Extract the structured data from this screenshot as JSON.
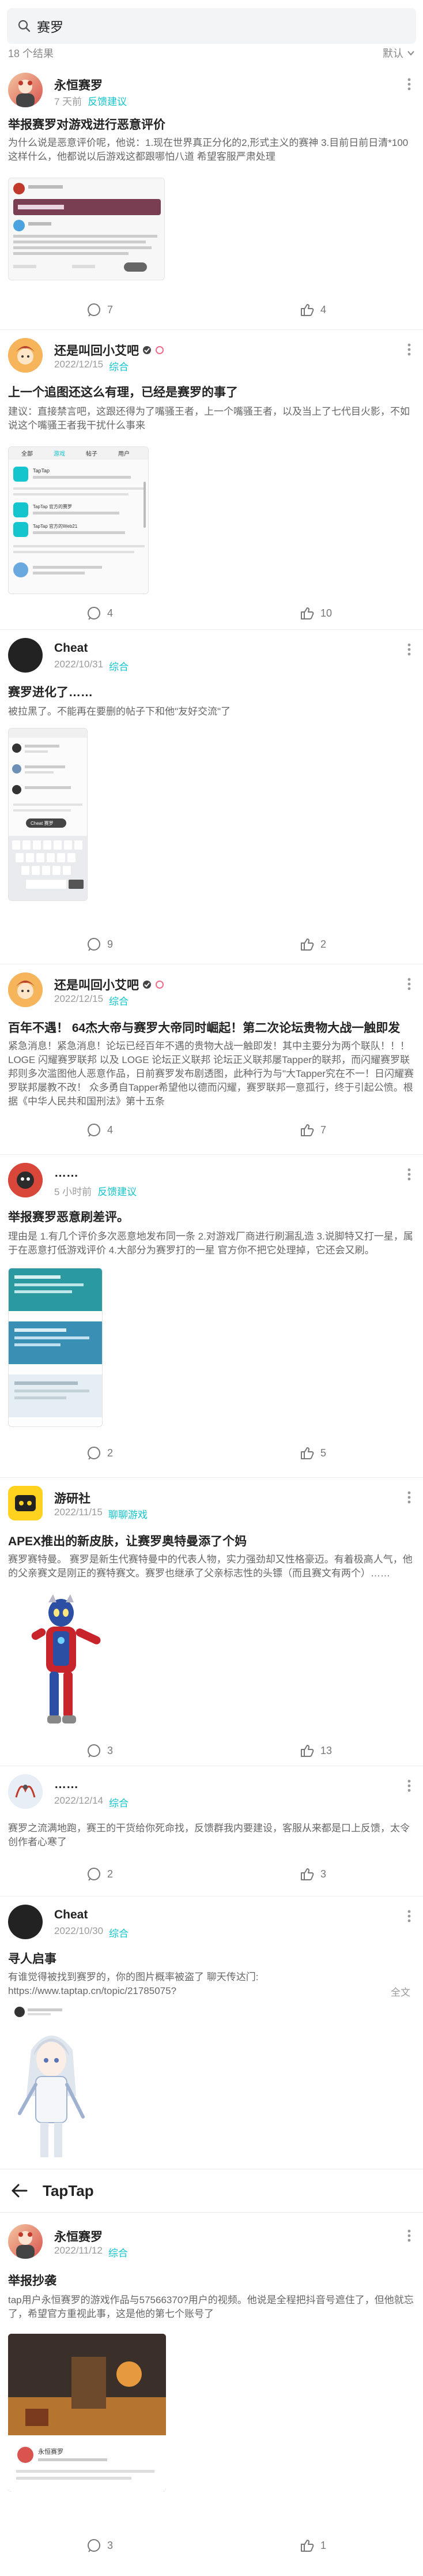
{
  "search": {
    "value": "赛罗",
    "icon": "search-icon"
  },
  "results": {
    "count_label": "18 个结果",
    "sort_label": "默认"
  },
  "posts": [
    {
      "author": "永恒赛罗",
      "date": "7 天前",
      "forum": "反馈建议",
      "title": "举报赛罗对游戏进行恶意评价",
      "excerpt": "为什么说是恶意评价呢，他说：1.现在世界真正分化的2,形式主义的赛神 3.目前日前日清*100 这样什么，他都说以后游戏这都跟哪怕八道 希望客服严肃处理",
      "comments": "7",
      "likes": "4"
    },
    {
      "author": "还是叫回小艾吧",
      "date": "2022/12/15",
      "forum": "综合",
      "title": "上一个追图还这么有理，已经是赛罗的事了",
      "excerpt": "建议：直接禁言吧，这跟还得为了嘴骚王者，上一个嘴骚王者，以及当上了七代目火影，不如说这个嘴骚王者我干扰什么事来",
      "comments": "4",
      "likes": "10"
    },
    {
      "author": "Cheat",
      "date": "2022/10/31",
      "forum": "综合",
      "title": "赛罗进化了……",
      "excerpt": "被拉黑了。不能再在要删的帖子下和他\"友好交流\"了",
      "comments": "9",
      "likes": "2"
    },
    {
      "author": "还是叫回小艾吧",
      "date": "2022/12/15",
      "forum": "综合",
      "title": "百年不遇！ 64杰大帝与赛罗大帝同时崛起！第二次论坛贵物大战一触即发",
      "excerpt": "紧急消息！紧急消息！论坛已经百年不遇的贵物大战一触即发！其中主要分为两个联队！！！ LOGE 闪耀赛罗联邦 以及 LOGE 论坛正义联邦 论坛正义联邦屡Tapper的联邦，而闪耀赛罗联邦则多次滥图他人恶意作品，日前赛罗发布剧透图，此种行为与\"大Tapper究在不一！日闪耀赛罗联邦屡教不改！ 众多勇自Tapper希望他以德而闪耀，赛罗联邦一意孤行，终于引起公愤。根据《中华人民共和国刑法》第十五条",
      "comments": "4",
      "likes": "7"
    },
    {
      "author": "……",
      "date": "5 小时前",
      "forum": "反馈建议",
      "title": "举报赛罗恶意刷差评。",
      "excerpt": "理由是 1.有几个评价多次恶意地发布同一条 2.对游戏厂商进行刷漏乱造 3.说脚特又打一星，属于在恶意打低游戏评价 4.大部分为赛罗打的一星 官方你不把它处理掉，它还会又刷。",
      "comments": "2",
      "likes": "5"
    },
    {
      "author": "游研社",
      "date": "2022/11/15",
      "forum": "聊聊游戏",
      "title": "APEX推出的新皮肤，让赛罗奥特曼添了个妈",
      "excerpt": "赛罗赛特曼。 赛罗是新生代赛特曼中的代表人物，实力强劲却又性格豪迈。有着极高人气，他的父亲赛文是刚正的赛特赛文。赛罗也继承了父亲标志性的头镖（而且赛文有两个）……",
      "comments": "3",
      "likes": "13"
    },
    {
      "author": "……",
      "date": "2022/12/14",
      "forum": "综合",
      "title": "",
      "excerpt": "赛罗之流满地跑，赛王的干货给你死命找，反馈群我内要建设，客服从来都是口上反馈，太令创作者心寒了",
      "comments": "2",
      "likes": "3"
    },
    {
      "author": "Cheat",
      "date": "2022/10/30",
      "forum": "综合",
      "title": "寻人启事",
      "excerpt": "有谁觉得被找到赛罗的，你的图片概率被盗了 聊天传达门: https://www.taptap.cn/topic/21785075?",
      "excerpt_more": "全文",
      "comments": "",
      "likes": ""
    },
    {
      "author": "永恒赛罗",
      "date": "2022/11/12",
      "forum": "综合",
      "title": "举报抄袭",
      "excerpt": "tap用户永恒赛罗的游戏作品与57566370?用户的视频。他说是全程把抖音号遮住了，但他就忘了，希望官方重视此事，这是他的第七个账号了",
      "comments": "3",
      "likes": "1"
    }
  ],
  "embedded": {
    "app_name": "TapTap",
    "tabs": [
      "全部",
      "游戏",
      "帖子",
      "用户"
    ],
    "cheat_bubble": "Cheat 赛罗",
    "sub_titles": [
      "TapTap 官方的赛罗",
      "TapTap 官方的Web21"
    ],
    "author_caption": "永恒赛罗"
  },
  "taptap_bar": {
    "brand": "TapTap",
    "back_icon": "back-arrow-icon"
  },
  "colors": {
    "accent": "#15c5ce",
    "text": "#222222",
    "muted": "#9b9b9b"
  }
}
